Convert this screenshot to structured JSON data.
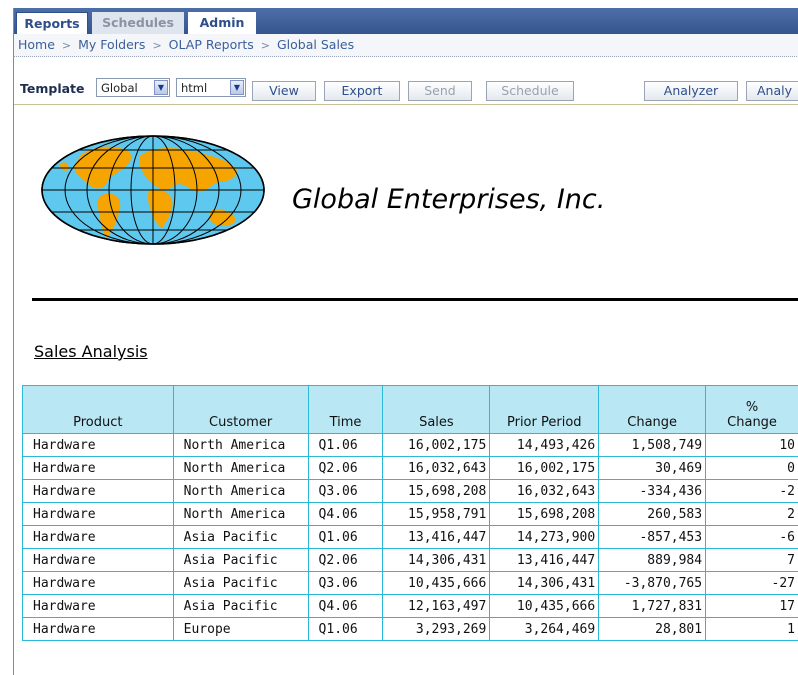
{
  "tabs": [
    {
      "label": "Reports",
      "state": "active"
    },
    {
      "label": "Schedules",
      "state": "inactive"
    },
    {
      "label": "Admin",
      "state": "normal"
    }
  ],
  "breadcrumb": {
    "separator": ">",
    "items": [
      "Home",
      "My Folders",
      "OLAP Reports",
      "Global Sales"
    ]
  },
  "toolbar": {
    "template_label": "Template",
    "template_value": "Global",
    "format_value": "html",
    "view_label": "View",
    "export_label": "Export",
    "send_label": "Send",
    "schedule_label": "Schedule",
    "analyzer_label": "Analyzer",
    "analyzer2_label": "Analy"
  },
  "report": {
    "company": "Global Enterprises, Inc.",
    "section_title": "Sales Analysis"
  },
  "table": {
    "headers": [
      "Product",
      "Customer",
      "Time",
      "Sales",
      "Prior Period",
      "Change",
      "% Change"
    ],
    "rows": [
      [
        "Hardware",
        "North America",
        "Q1.06",
        "16,002,175",
        "14,493,426",
        "1,508,749",
        "10"
      ],
      [
        "Hardware",
        "North America",
        "Q2.06",
        "16,032,643",
        "16,002,175",
        "30,469",
        "0"
      ],
      [
        "Hardware",
        "North America",
        "Q3.06",
        "15,698,208",
        "16,032,643",
        "-334,436",
        "-2"
      ],
      [
        "Hardware",
        "North America",
        "Q4.06",
        "15,958,791",
        "15,698,208",
        "260,583",
        "2"
      ],
      [
        "Hardware",
        "Asia Pacific",
        "Q1.06",
        "13,416,447",
        "14,273,900",
        "-857,453",
        "-6"
      ],
      [
        "Hardware",
        "Asia Pacific",
        "Q2.06",
        "14,306,431",
        "13,416,447",
        "889,984",
        "7"
      ],
      [
        "Hardware",
        "Asia Pacific",
        "Q3.06",
        "10,435,666",
        "14,306,431",
        "-3,870,765",
        "-27"
      ],
      [
        "Hardware",
        "Asia Pacific",
        "Q4.06",
        "12,163,497",
        "10,435,666",
        "1,727,831",
        "17"
      ],
      [
        "Hardware",
        "Europe",
        "Q1.06",
        "3,293,269",
        "3,264,469",
        "28,801",
        "1"
      ]
    ]
  },
  "colors": {
    "tab_bar": "#3f5f99",
    "header_fill": "#b9e8f4",
    "grid_border": "#2bb9d8",
    "globe_land": "#f5a400",
    "globe_water": "#5fc8ee"
  },
  "icons": {
    "logo": "globe-logo-icon",
    "dropdown": "chevron-down-icon"
  }
}
